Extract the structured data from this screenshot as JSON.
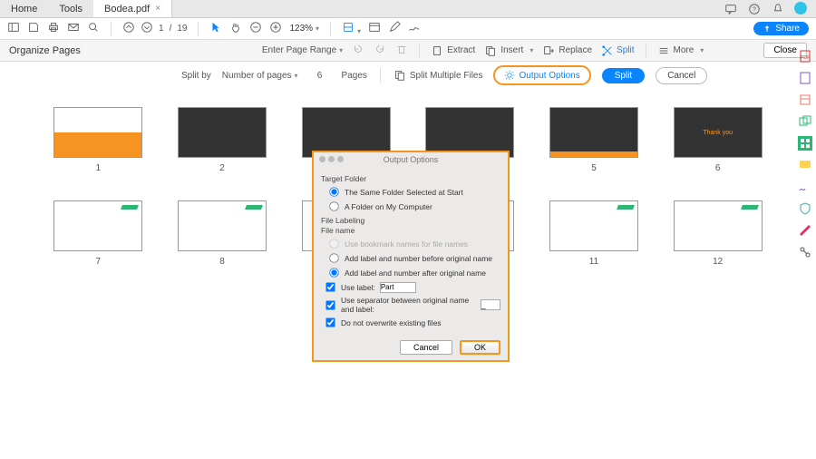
{
  "tabs": {
    "home": "Home",
    "tools": "Tools",
    "doc": "Bodea.pdf"
  },
  "toolbar": {
    "page_current": "1",
    "page_sep": "/",
    "page_total": "19",
    "zoom": "123%",
    "share": "Share"
  },
  "subbar": {
    "title": "Organize Pages",
    "page_range": "Enter Page Range",
    "extract": "Extract",
    "insert": "Insert",
    "replace": "Replace",
    "split": "Split",
    "more": "More",
    "close": "Close"
  },
  "splitbar": {
    "split_by": "Split by",
    "mode": "Number of pages",
    "count": "6",
    "pages": "Pages",
    "multi": "Split Multiple Files",
    "output_options": "Output Options",
    "split_btn": "Split",
    "cancel": "Cancel"
  },
  "thumbs": {
    "p1": "1",
    "p2": "2",
    "p5": "5",
    "p6": "6",
    "p7": "7",
    "p8": "8",
    "p11": "11",
    "p12": "12",
    "thank": "Thank you"
  },
  "dialog": {
    "title": "Output Options",
    "target_folder": "Target Folder",
    "opt_same": "The Same Folder Selected at Start",
    "opt_my": "A Folder on My Computer",
    "file_labeling": "File Labeling",
    "file_name": "File name",
    "use_bookmark": "Use bookmark names for file names",
    "before": "Add label and number before original name",
    "after": "Add label and number after original name",
    "use_label": "Use label:",
    "use_label_val": "Part",
    "use_sep": "Use separator between original name and label:",
    "use_sep_val": "_",
    "no_overwrite": "Do not overwrite existing files",
    "cancel": "Cancel",
    "ok": "OK"
  }
}
